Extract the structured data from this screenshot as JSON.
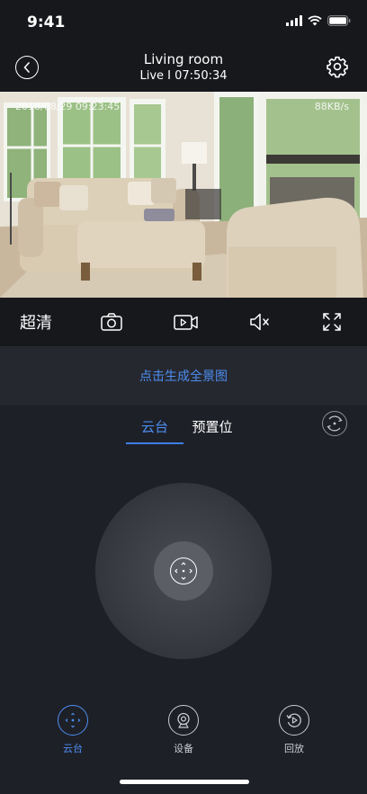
{
  "status_bar": {
    "time": "9:41"
  },
  "header": {
    "title": "Living room",
    "subtitle": "Live I 07:50:34"
  },
  "video": {
    "timestamp": "2018/08/29  09:23:45",
    "bitrate": "88KB/s"
  },
  "controls": {
    "quality_label": "超清",
    "icons": [
      "camera-icon",
      "video-record-icon",
      "mute-icon",
      "fullscreen-icon"
    ]
  },
  "panorama": {
    "link_label": "点击生成全景图"
  },
  "tabs": [
    {
      "label": "云台",
      "active": true
    },
    {
      "label": "预置位",
      "active": false
    }
  ],
  "bottom_nav": [
    {
      "label": "云台",
      "icon": "ptz-icon",
      "active": true
    },
    {
      "label": "设备",
      "icon": "device-camera-icon",
      "active": false
    },
    {
      "label": "回放",
      "icon": "playback-icon",
      "active": false
    }
  ],
  "colors": {
    "accent": "#4c8ef0",
    "background": "#1e2028",
    "bar": "#17181c"
  }
}
